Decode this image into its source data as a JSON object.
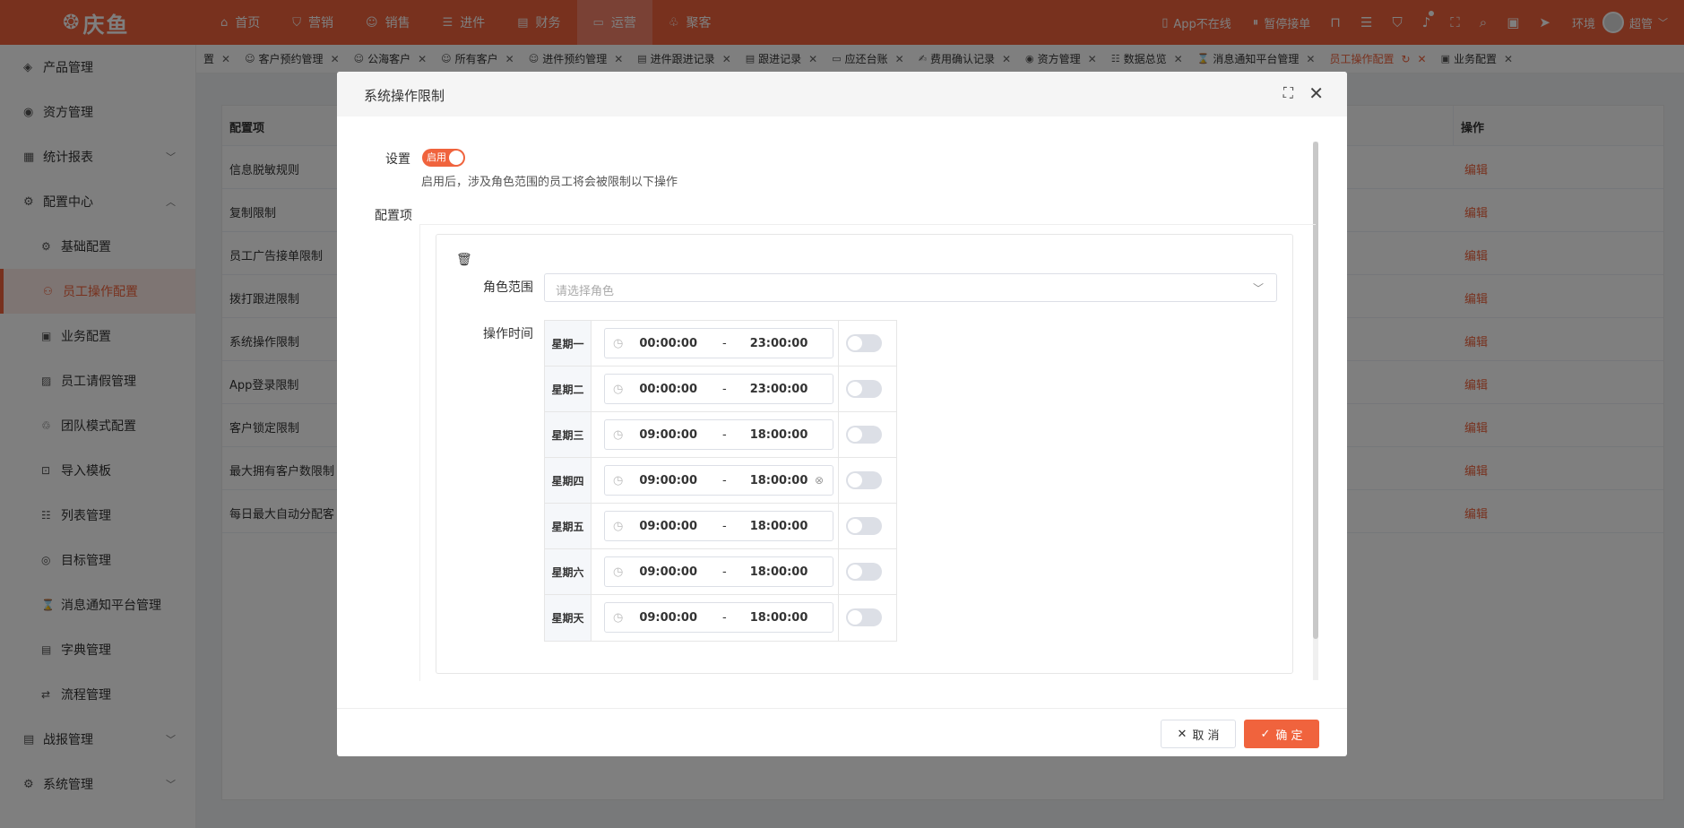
{
  "app": {
    "logo_text": "庆鱼"
  },
  "topnav": [
    {
      "label": "首页",
      "icon": "home-icon",
      "glyph": "⌂"
    },
    {
      "label": "营销",
      "icon": "shield-icon",
      "glyph": "⛉"
    },
    {
      "label": "销售",
      "icon": "person-icon",
      "glyph": "☺"
    },
    {
      "label": "进件",
      "icon": "document-icon",
      "glyph": "☰"
    },
    {
      "label": "财务",
      "icon": "ledger-icon",
      "glyph": "▤"
    },
    {
      "label": "运营",
      "icon": "monitor-icon",
      "glyph": "▭"
    },
    {
      "label": "聚客",
      "icon": "group-icon",
      "glyph": "♧"
    }
  ],
  "topright": {
    "app_status": "App不在线",
    "pause_order": "暂停接单",
    "env": "环境",
    "user": "超管"
  },
  "sidebar": {
    "items": [
      {
        "label": "产品管理",
        "glyph": "◈"
      },
      {
        "label": "资方管理",
        "glyph": "◉"
      },
      {
        "label": "统计报表",
        "glyph": "▦"
      },
      {
        "label": "配置中心",
        "glyph": "⚙"
      }
    ],
    "subs": [
      {
        "label": "基础配置",
        "glyph": "⚙"
      },
      {
        "label": "员工操作配置",
        "glyph": "⚇"
      },
      {
        "label": "业务配置",
        "glyph": "▣"
      },
      {
        "label": "员工请假管理",
        "glyph": "▨"
      },
      {
        "label": "团队模式配置",
        "glyph": "♲"
      },
      {
        "label": "导入模板",
        "glyph": "⊡"
      },
      {
        "label": "列表管理",
        "glyph": "☷"
      },
      {
        "label": "目标管理",
        "glyph": "◎"
      },
      {
        "label": "消息通知平台管理",
        "glyph": "⌛"
      },
      {
        "label": "字典管理",
        "glyph": "▤"
      },
      {
        "label": "流程管理",
        "glyph": "⇄"
      }
    ],
    "bottom": [
      {
        "label": "战报管理",
        "glyph": "▤"
      },
      {
        "label": "系统管理",
        "glyph": "⚙"
      }
    ]
  },
  "tabs": [
    {
      "label": "置",
      "glyph": ""
    },
    {
      "label": "客户预约管理",
      "glyph": "☺"
    },
    {
      "label": "公海客户",
      "glyph": "☺"
    },
    {
      "label": "所有客户",
      "glyph": "☺"
    },
    {
      "label": "进件预约管理",
      "glyph": "☺"
    },
    {
      "label": "进件跟进记录",
      "glyph": "▤"
    },
    {
      "label": "跟进记录",
      "glyph": "▤"
    },
    {
      "label": "应还台账",
      "glyph": "▭"
    },
    {
      "label": "费用确认记录",
      "glyph": "✍"
    },
    {
      "label": "资方管理",
      "glyph": "◉"
    },
    {
      "label": "数据总览",
      "glyph": "☷"
    },
    {
      "label": "消息通知平台管理",
      "glyph": "⌛"
    },
    {
      "label": "员工操作配置",
      "glyph": ""
    },
    {
      "label": "业务配置",
      "glyph": "▣"
    }
  ],
  "table": {
    "headers": {
      "item": "配置项",
      "action": "操作"
    },
    "rows": [
      {
        "name": "信息脱敏规则",
        "action": "编辑"
      },
      {
        "name": "复制限制",
        "action": "编辑"
      },
      {
        "name": "员工广告接单限制",
        "action": "编辑"
      },
      {
        "name": "拨打跟进限制",
        "action": "编辑"
      },
      {
        "name": "系统操作限制",
        "action": "编辑"
      },
      {
        "name": "App登录限制",
        "action": "编辑"
      },
      {
        "name": "客户锁定限制",
        "action": "编辑"
      },
      {
        "name": "最大拥有客户数限制",
        "action": "编辑"
      },
      {
        "name": "每日最大自动分配客",
        "action": "编辑"
      }
    ]
  },
  "modal": {
    "title": "系统操作限制",
    "setting_label": "设置",
    "switch_text": "启用",
    "hint": "启用后，涉及角色范围的员工将会被限制以下操作",
    "config_label": "配置项",
    "role_label": "角色范围",
    "role_placeholder": "请选择角色",
    "time_label": "操作时间",
    "days": [
      {
        "day": "星期一",
        "start": "00:00:00",
        "end": "23:00:00",
        "enabled": false
      },
      {
        "day": "星期二",
        "start": "00:00:00",
        "end": "23:00:00",
        "enabled": false
      },
      {
        "day": "星期三",
        "start": "09:00:00",
        "end": "18:00:00",
        "enabled": false
      },
      {
        "day": "星期四",
        "start": "09:00:00",
        "end": "18:00:00",
        "enabled": false
      },
      {
        "day": "星期五",
        "start": "09:00:00",
        "end": "18:00:00",
        "enabled": false
      },
      {
        "day": "星期六",
        "start": "09:00:00",
        "end": "18:00:00",
        "enabled": false
      },
      {
        "day": "星期天",
        "start": "09:00:00",
        "end": "18:00:00",
        "enabled": false
      }
    ],
    "cancel_label": "取 消",
    "ok_label": "确 定"
  },
  "colors": {
    "brand": "#f0633d"
  }
}
